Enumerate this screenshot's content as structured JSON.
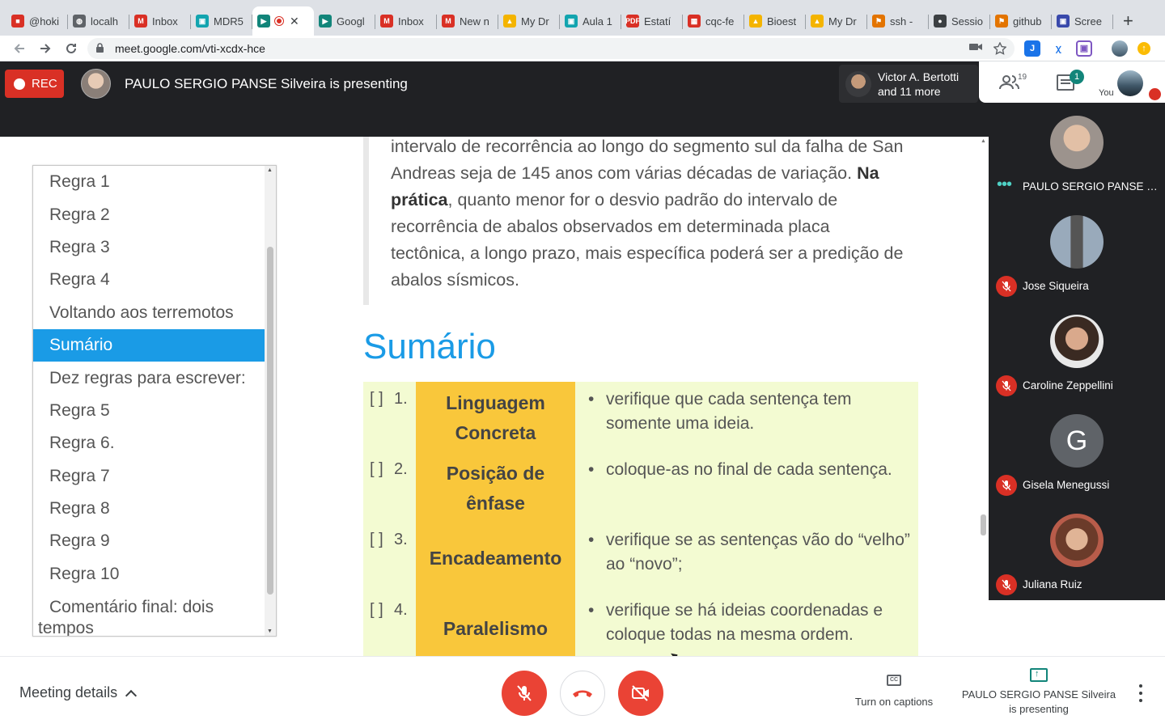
{
  "browser": {
    "tabs": [
      {
        "label": "@hoki",
        "color": "#d93025",
        "glyph": "■"
      },
      {
        "label": "localh",
        "color": "#5f6368",
        "glyph": "◍"
      },
      {
        "label": "Inbox",
        "color": "#d93025",
        "glyph": "M"
      },
      {
        "label": "MDR5",
        "color": "#12a4af",
        "glyph": "▣"
      },
      {
        "label": "",
        "color": "#12857a",
        "glyph": "▶",
        "active": true
      },
      {
        "label": "Googl",
        "color": "#12857a",
        "glyph": "▶"
      },
      {
        "label": "Inbox",
        "color": "#d93025",
        "glyph": "M"
      },
      {
        "label": "New n",
        "color": "#d93025",
        "glyph": "M"
      },
      {
        "label": "My Dr",
        "color": "#f4b400",
        "glyph": "▲"
      },
      {
        "label": "Aula 1",
        "color": "#12a4af",
        "glyph": "▣"
      },
      {
        "label": "Estatí",
        "color": "#d93025",
        "glyph": "PDF"
      },
      {
        "label": "cqc-fe",
        "color": "#d93025",
        "glyph": "▦"
      },
      {
        "label": "Bioest",
        "color": "#f4b400",
        "glyph": "▲"
      },
      {
        "label": "My Dr",
        "color": "#f4b400",
        "glyph": "▲"
      },
      {
        "label": "ssh - ",
        "color": "#e37400",
        "glyph": "⚑"
      },
      {
        "label": "Sessio",
        "color": "#3c4043",
        "glyph": "●"
      },
      {
        "label": "github",
        "color": "#e37400",
        "glyph": "⚑"
      },
      {
        "label": "Scree",
        "color": "#3949ab",
        "glyph": "▣"
      }
    ],
    "new_tab": "+",
    "url": "meet.google.com/vti-xcdx-hce"
  },
  "meet": {
    "rec_label": "REC",
    "presenting_title": "PAULO SERGIO PANSE Silveira is presenting",
    "others_line1": "Victor A. Bertotti",
    "others_line2": "and 11 more",
    "people_count": "19",
    "chat_badge": "1",
    "you_label": "You"
  },
  "outline": {
    "items": [
      "Regra 1",
      "Regra 2",
      "Regra 3",
      "Regra 4",
      "Voltando aos terremotos",
      "Sumário",
      "Dez regras para escrever:",
      "Regra 5",
      "Regra 6.",
      "Regra 7",
      "Regra 8",
      "Regra 9",
      "Regra 10"
    ],
    "selected_index": 5,
    "last_item_line1": "Comentário final: dois",
    "last_item_line2": "tempos"
  },
  "slide": {
    "quote_part1": "intervalo de recorrência ao longo do segmento sul da falha de San Andreas seja de 145 anos com várias décadas de variação. ",
    "quote_bold": "Na prática",
    "quote_part2": ", quanto menor for o desvio padrão do intervalo de recorrência de abalos observados em determinada placa tectônica, a longo prazo, mais específica poderá ser a predição de abalos sísmicos.",
    "title": "Sumário",
    "rows": [
      {
        "check": "[ ]",
        "num": "1.",
        "term": "Linguagem Concreta",
        "desc": "verifique que cada sentença tem somente uma ideia."
      },
      {
        "check": "[ ]",
        "num": "2.",
        "term": "Posição de ênfase",
        "desc": "coloque-as no final de cada sentença."
      },
      {
        "check": "[ ]",
        "num": "3.",
        "term": "Encadeamento",
        "desc": "verifique se as sentenças vão do “velho” ao “novo”;"
      },
      {
        "check": "[ ]",
        "num": "4.",
        "term": "Paralelismo",
        "desc": "verifique se há ideias coordenadas e coloque todas na mesma ordem."
      }
    ]
  },
  "participants": [
    {
      "name": "PAULO SERGIO PANSE Sil...",
      "speaking": true,
      "avatar": "photo-man-gray"
    },
    {
      "name": "Jose Siqueira",
      "muted": true,
      "avatar": "photo-tower"
    },
    {
      "name": "Caroline Zeppellini",
      "muted": true,
      "avatar": "photo-woman"
    },
    {
      "name": "Gisela Menegussi",
      "muted": true,
      "avatar": "G"
    },
    {
      "name": "Juliana Ruiz",
      "muted": true,
      "avatar": "photo-woman-2"
    }
  ],
  "bottom": {
    "meeting_details": "Meeting details",
    "captions": "Turn on captions",
    "presenting_status": "PAULO SERGIO PANSE Silveira is presenting"
  },
  "colors": {
    "meet_dark": "#202124",
    "danger": "#ea4335",
    "slide_blue": "#1a9be6",
    "table_yellow": "#f9c73b",
    "table_green": "#f3fbd2"
  }
}
